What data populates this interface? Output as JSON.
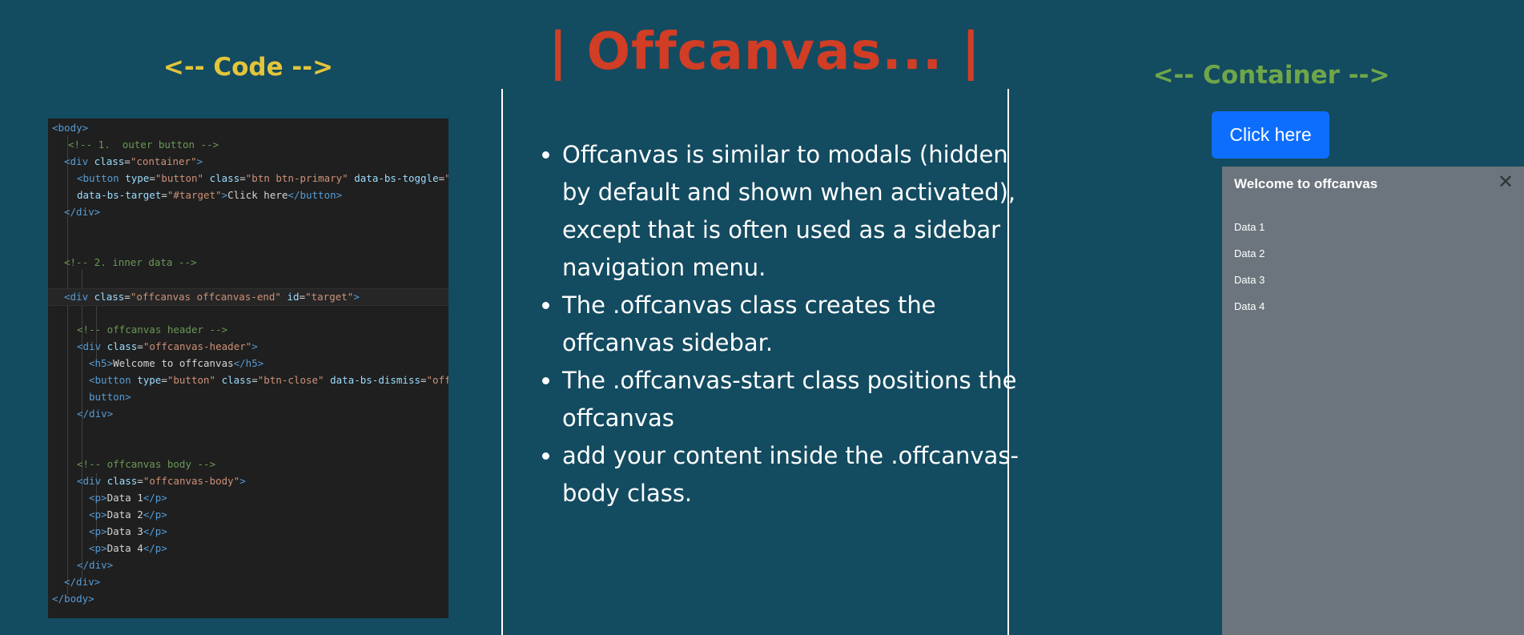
{
  "headings": {
    "code": "<-- Code -->",
    "title": "| Offcanvas... |",
    "container": "<-- Container -->"
  },
  "colors": {
    "background": "#134b60",
    "code_heading": "#e3c53a",
    "title": "#d13d25",
    "container_heading": "#6fa64a",
    "primary_button": "#0d6efd",
    "offcanvas_bg": "#6c757d"
  },
  "bullets": [
    "Offcanvas is similar to modals (hidden by default and shown when activated), except that is often used as a sidebar navigation menu.",
    "The .offcanvas class creates the offcanvas sidebar.",
    "The .offcanvas-start class positions the offcanvas",
    "add your content inside the .offcanvas-body class."
  ],
  "demo": {
    "button_label": "Click here",
    "offcanvas_title": "Welcome to offcanvas",
    "close_icon": "close-icon",
    "items": [
      "Data 1",
      "Data 2",
      "Data 3",
      "Data 4"
    ]
  },
  "code": {
    "lines": [
      [
        [
          "tag",
          "<body>"
        ]
      ],
      [
        [
          "cmt",
          "<!-- 1.  outer button -->"
        ]
      ],
      [
        [
          "tag",
          "<div "
        ],
        [
          "attr",
          "class"
        ],
        [
          "txt",
          "="
        ],
        [
          "str",
          "\"container\""
        ],
        [
          "tag",
          ">"
        ]
      ],
      [
        [
          "tag",
          "<button "
        ],
        [
          "attr",
          "type"
        ],
        [
          "txt",
          "="
        ],
        [
          "str",
          "\"button\""
        ],
        [
          "txt",
          " "
        ],
        [
          "attr",
          "class"
        ],
        [
          "txt",
          "="
        ],
        [
          "str",
          "\"btn btn-primary\""
        ],
        [
          "txt",
          " "
        ],
        [
          "attr",
          "data-bs-toggle"
        ],
        [
          "txt",
          "="
        ],
        [
          "str",
          "\"offcanvas\""
        ]
      ],
      [
        [
          "attr",
          "data-bs-target"
        ],
        [
          "txt",
          "="
        ],
        [
          "str",
          "\"#target\""
        ],
        [
          "tag",
          ">"
        ],
        [
          "txt",
          "Click here"
        ],
        [
          "tag",
          "</button>"
        ]
      ],
      [
        [
          "tag",
          "</div>"
        ]
      ],
      [
        [
          "cmt",
          "<!-- 2. inner data -->"
        ]
      ],
      [
        [
          "tag",
          "<div "
        ],
        [
          "attr",
          "class"
        ],
        [
          "txt",
          "="
        ],
        [
          "str",
          "\"offcanvas offcanvas-end\""
        ],
        [
          "txt",
          " "
        ],
        [
          "attr",
          "id"
        ],
        [
          "txt",
          "="
        ],
        [
          "str",
          "\"target\""
        ],
        [
          "tag",
          ">"
        ]
      ],
      [
        [
          "cmt",
          "<!-- offcanvas header -->"
        ]
      ],
      [
        [
          "tag",
          "<div "
        ],
        [
          "attr",
          "class"
        ],
        [
          "txt",
          "="
        ],
        [
          "str",
          "\"offcanvas-header\""
        ],
        [
          "tag",
          ">"
        ]
      ],
      [
        [
          "tag",
          "<h5>"
        ],
        [
          "txt",
          "Welcome to offcanvas"
        ],
        [
          "tag",
          "</h5>"
        ]
      ],
      [
        [
          "tag",
          "<button "
        ],
        [
          "attr",
          "type"
        ],
        [
          "txt",
          "="
        ],
        [
          "str",
          "\"button\""
        ],
        [
          "txt",
          " "
        ],
        [
          "attr",
          "class"
        ],
        [
          "txt",
          "="
        ],
        [
          "str",
          "\"btn-close\""
        ],
        [
          "txt",
          " "
        ],
        [
          "attr",
          "data-bs-dismiss"
        ],
        [
          "txt",
          "="
        ],
        [
          "str",
          "\"offcanvas\""
        ],
        [
          "tag",
          "></"
        ]
      ],
      [
        [
          "tag",
          "button>"
        ]
      ],
      [
        [
          "tag",
          "</div>"
        ]
      ],
      [
        [
          "cmt",
          "<!-- offcanvas body -->"
        ]
      ],
      [
        [
          "tag",
          "<div "
        ],
        [
          "attr",
          "class"
        ],
        [
          "txt",
          "="
        ],
        [
          "str",
          "\"offcanvas-body\""
        ],
        [
          "tag",
          ">"
        ]
      ],
      [
        [
          "tag",
          "<p>"
        ],
        [
          "txt",
          "Data 1"
        ],
        [
          "tag",
          "</p>"
        ]
      ],
      [
        [
          "tag",
          "<p>"
        ],
        [
          "txt",
          "Data 2"
        ],
        [
          "tag",
          "</p>"
        ]
      ],
      [
        [
          "tag",
          "<p>"
        ],
        [
          "txt",
          "Data 3"
        ],
        [
          "tag",
          "</p>"
        ]
      ],
      [
        [
          "tag",
          "<p>"
        ],
        [
          "txt",
          "Data 4"
        ],
        [
          "tag",
          "</p>"
        ]
      ],
      [
        [
          "tag",
          "</div>"
        ]
      ],
      [
        [
          "tag",
          "</div>"
        ]
      ],
      [
        [
          "tag",
          "</body>"
        ]
      ]
    ]
  }
}
